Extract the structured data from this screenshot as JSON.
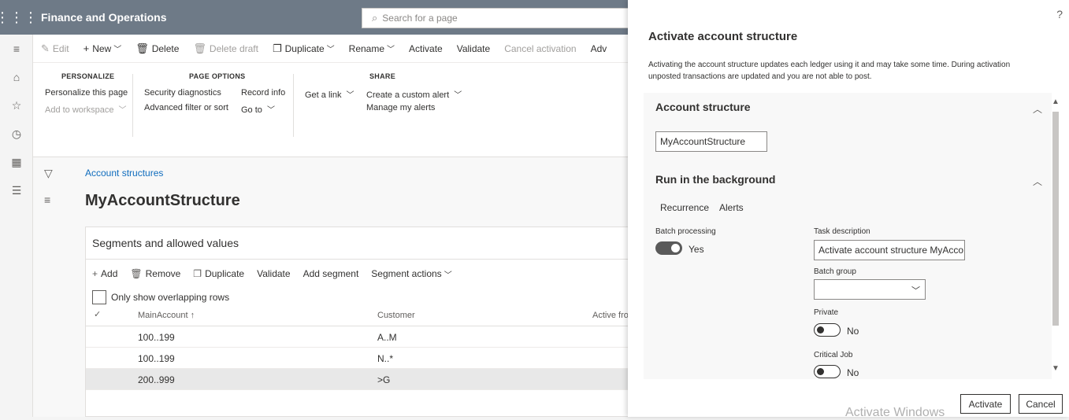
{
  "header": {
    "app_title": "Finance and Operations",
    "search_placeholder": "Search for a page"
  },
  "actionbar": {
    "edit": "Edit",
    "new": "New",
    "delete": "Delete",
    "delete_draft": "Delete draft",
    "duplicate": "Duplicate",
    "rename": "Rename",
    "activate": "Activate",
    "validate": "Validate",
    "cancel_activation": "Cancel activation",
    "adv": "Adv"
  },
  "ribbon": {
    "personalize": {
      "header": "PERSONALIZE",
      "personalize_page": "Personalize this page",
      "add_to_workspace": "Add to workspace"
    },
    "page_options": {
      "header": "PAGE OPTIONS",
      "security_diagnostics": "Security diagnostics",
      "advanced_filter": "Advanced filter or sort",
      "record_info": "Record info",
      "go_to": "Go to"
    },
    "get_link": "Get a link",
    "share": {
      "header": "SHARE",
      "custom_alert": "Create a custom alert",
      "manage_alerts": "Manage my alerts"
    }
  },
  "main": {
    "breadcrumb": "Account structures",
    "title": "MyAccountStructure",
    "card_title": "Segments and allowed values",
    "grid_actions": {
      "add": "Add",
      "remove": "Remove",
      "duplicate": "Duplicate",
      "validate": "Validate",
      "add_segment": "Add segment",
      "segment_actions": "Segment actions"
    },
    "overlap_label": "Only show overlapping rows",
    "columns": {
      "main_account": "MainAccount",
      "customer": "Customer",
      "active_from": "Active fro"
    },
    "rows": [
      {
        "main_account": "100..199",
        "customer": "A..M"
      },
      {
        "main_account": "100..199",
        "customer": "N..*"
      },
      {
        "main_account": "200..999",
        "customer": ">G"
      }
    ]
  },
  "panel": {
    "help": "?",
    "title": "Activate account structure",
    "description": "Activating the account structure updates each ledger using it and may take some time. During activation unposted transactions are updated and you are not able to post.",
    "account_structure": {
      "header": "Account structure",
      "value": "MyAccountStructure"
    },
    "run_in_background": {
      "header": "Run in the background",
      "tab_recurrence": "Recurrence",
      "tab_alerts": "Alerts",
      "batch_processing_label": "Batch processing",
      "batch_processing_value": "Yes",
      "task_description_label": "Task description",
      "task_description_value": "Activate account structure MyAcco",
      "batch_group_label": "Batch group",
      "batch_group_value": "",
      "private_label": "Private",
      "private_value": "No",
      "critical_job_label": "Critical Job",
      "critical_job_value": "No"
    },
    "activate_button": "Activate",
    "cancel_button": "Cancel",
    "watermark": "Activate Windows"
  }
}
